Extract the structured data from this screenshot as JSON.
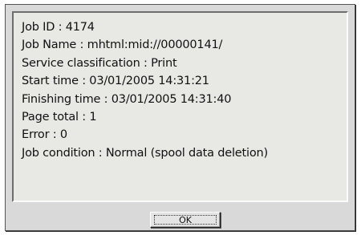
{
  "job_info": {
    "lines": [
      "Job ID : 4174",
      "Job Name : mhtml:mid://00000141/",
      "Service classification : Print",
      "Start time : 03/01/2005 14:31:21",
      "Finishing time : 03/01/2005 14:31:40",
      "Page total :  1",
      "Error :  0",
      "Job condition :  Normal (spool data deletion)"
    ]
  },
  "buttons": {
    "ok_label": "OK"
  }
}
